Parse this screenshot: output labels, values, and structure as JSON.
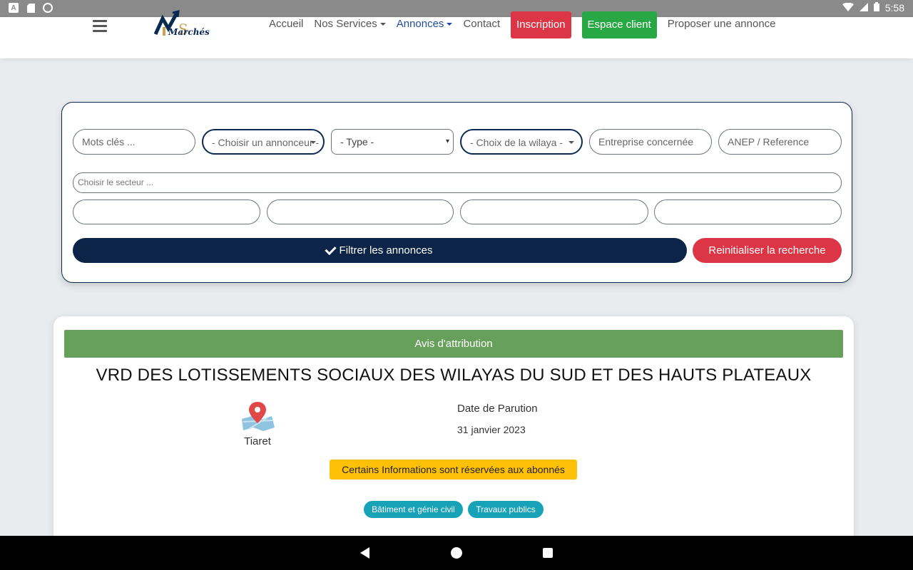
{
  "status_bar": {
    "time": "5:58",
    "left_icons": [
      "text-a-icon",
      "sd-card-icon",
      "record-icon"
    ],
    "right_icons": [
      "wifi-icon",
      "signal-icon",
      "battery-icon"
    ]
  },
  "nav": {
    "logo_text": "Marchés",
    "links": [
      {
        "label": "Accueil",
        "dropdown": false
      },
      {
        "label": "Nos Services",
        "dropdown": true
      },
      {
        "label": "Annonces",
        "dropdown": true,
        "active": true
      },
      {
        "label": "Contact",
        "dropdown": false
      }
    ],
    "signup": "Inscription",
    "client_area": "Espace client",
    "propose": "Proposer une annonce"
  },
  "filters": {
    "keywords_placeholder": "Mots clés ...",
    "advertiser_placeholder": "- Choisir un annonceur -",
    "type_placeholder": "- Type -",
    "wilaya_placeholder": "- Choix de la wilaya -",
    "company_placeholder": "Entreprise concernée",
    "anep_placeholder": "ANEP / Reference",
    "sector_placeholder": "Choisir le secteur ...",
    "filter_button": "Filtrer les annonces",
    "reset_button": "Reinitialiser la recherche"
  },
  "result": {
    "category": "Avis d'attribution",
    "title": "VRD DES LOTISSEMENTS SOCIAUX DES WILAYAS DU SUD ET DES HAUTS PLATEAUX",
    "location": "Tiaret",
    "date_label": "Date de Parution",
    "date_value": "31 janvier 2023",
    "notice": "Certains Informations sont réservées aux abonnés",
    "tags": [
      "Bâtiment et génie civil",
      "Travaux publics"
    ]
  },
  "colors": {
    "navy": "#0b2447",
    "red": "#dc3545",
    "green": "#28a745",
    "banner_green": "#67a05a",
    "notice_yellow": "#ffc107",
    "tag_teal": "#17a2b8"
  }
}
